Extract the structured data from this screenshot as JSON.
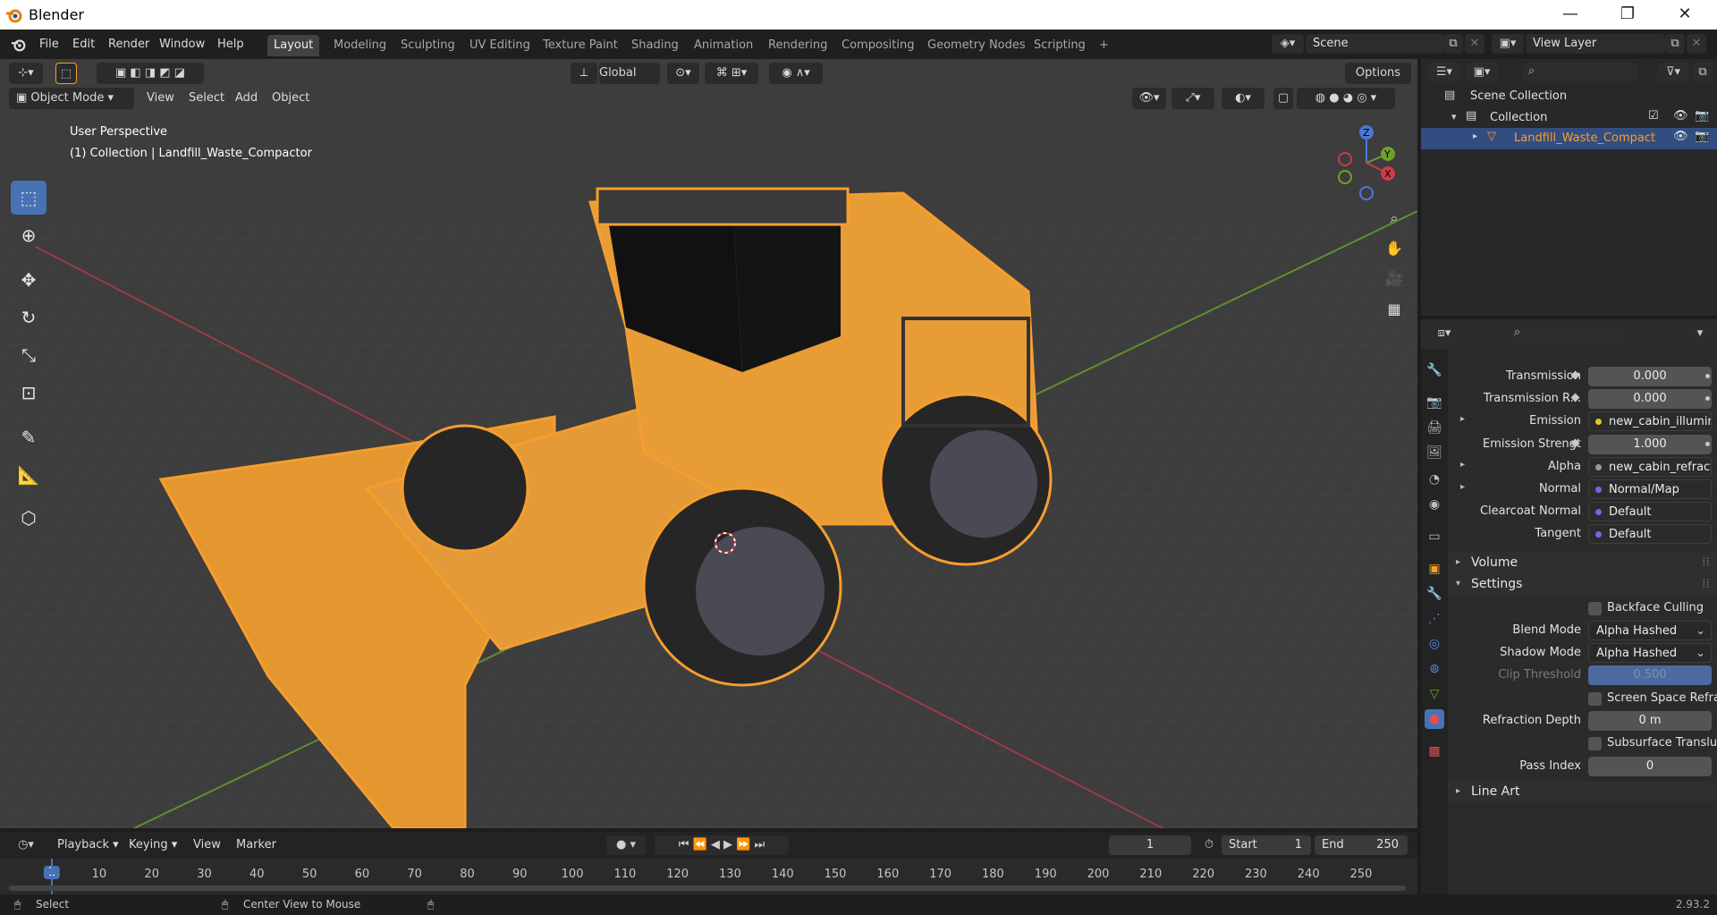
{
  "window": {
    "title": "Blender",
    "minimize": "—",
    "restore": "❐",
    "close": "✕"
  },
  "menu": [
    "File",
    "Edit",
    "Render",
    "Window",
    "Help"
  ],
  "workspaces": [
    "Layout",
    "Modeling",
    "Sculpting",
    "UV Editing",
    "Texture Paint",
    "Shading",
    "Animation",
    "Rendering",
    "Compositing",
    "Geometry Nodes",
    "Scripting"
  ],
  "active_workspace": "Layout",
  "add_workspace": "+",
  "scene": {
    "label": "Scene",
    "view_layer": "View Layer"
  },
  "viewport": {
    "orientation": "Global",
    "options": "Options",
    "mode": "Object Mode",
    "menus": [
      "View",
      "Select",
      "Add",
      "Object"
    ],
    "perspective": "User Perspective",
    "collection_info": "(1) Collection | Landfill_Waste_Compactor",
    "gizmo": {
      "z": "Z",
      "y": "Y",
      "x": "X"
    }
  },
  "outliner": {
    "search_placeholder": "",
    "scene_collection": "Scene Collection",
    "collection": "Collection",
    "object": "Landfill_Waste_Compact"
  },
  "properties": {
    "search_placeholder": "",
    "rows": [
      {
        "label": "Transmission",
        "value": "0.000",
        "kind": "num"
      },
      {
        "label": "Transmission R...",
        "value": "0.000",
        "kind": "num"
      },
      {
        "label": "Emission",
        "value": "new_cabin_illuminat...",
        "kind": "link",
        "dot": "#e6c62e",
        "expand": "▸"
      },
      {
        "label": "Emission Strengt",
        "value": "1.000",
        "kind": "num"
      },
      {
        "label": "Alpha",
        "value": "new_cabin_refract_i...",
        "kind": "link",
        "dot": "#e6c62e",
        "expand": "▸"
      },
      {
        "label": "Normal",
        "value": "Normal/Map",
        "kind": "link",
        "dot": "#6a6ae6",
        "expand": "▸"
      },
      {
        "label": "Clearcoat Normal",
        "value": "Default",
        "kind": "link",
        "dot": "#6a6ae6"
      },
      {
        "label": "Tangent",
        "value": "Default",
        "kind": "link",
        "dot": "#6a6ae6"
      }
    ],
    "volume": "Volume",
    "settings": "Settings",
    "backface_culling": "Backface Culling",
    "blend_mode": {
      "label": "Blend Mode",
      "value": "Alpha Hashed"
    },
    "shadow_mode": {
      "label": "Shadow Mode",
      "value": "Alpha Hashed"
    },
    "clip_threshold": {
      "label": "Clip Threshold",
      "value": "0.500"
    },
    "screen_space_refraction": "Screen Space Refraction",
    "refraction_depth": {
      "label": "Refraction Depth",
      "value": "0 m"
    },
    "subsurface_translucency": "Subsurface Translucency",
    "pass_index": {
      "label": "Pass Index",
      "value": "0"
    },
    "line_art": "Line Art"
  },
  "timeline": {
    "menus": [
      "Playback",
      "Keying",
      "View",
      "Marker"
    ],
    "current_frame": "1",
    "start_label": "Start",
    "start": "1",
    "end_label": "End",
    "end": "250",
    "ticks": [
      "1",
      "10",
      "20",
      "30",
      "40",
      "50",
      "60",
      "70",
      "80",
      "90",
      "100",
      "110",
      "120",
      "130",
      "140",
      "150",
      "160",
      "170",
      "180",
      "190",
      "200",
      "210",
      "220",
      "230",
      "240",
      "250"
    ]
  },
  "status": {
    "select": "Select",
    "center": "Center View to Mouse",
    "version": "2.93.2"
  },
  "colors": {
    "accent": "#4772b3",
    "selection": "#f59e2e",
    "active_object": "#f0a030"
  }
}
